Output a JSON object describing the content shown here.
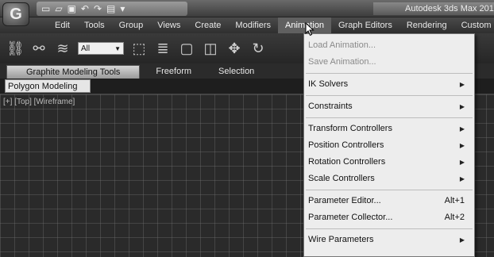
{
  "titlebar": {
    "app_button": "G",
    "title": "Autodesk 3ds Max 201",
    "quick_access_icons": [
      "new-file-icon",
      "open-file-icon",
      "save-icon",
      "undo-icon",
      "redo-icon",
      "project-folder-icon"
    ]
  },
  "menubar": {
    "items": [
      "Edit",
      "Tools",
      "Group",
      "Views",
      "Create",
      "Modifiers",
      "Animation",
      "Graph Editors",
      "Rendering",
      "Custom"
    ],
    "active": "Animation"
  },
  "toolbar": {
    "selection_filter": "All"
  },
  "ribbon": {
    "tabs": [
      "Graphite Modeling Tools",
      "Freeform",
      "Selection"
    ],
    "active_panel": "Polygon Modeling"
  },
  "viewport": {
    "label": "[+] [Top] [Wireframe]"
  },
  "animation_menu": {
    "items": [
      {
        "label": "Load Animation...",
        "shortcut": "",
        "submenu": false,
        "disabled": true
      },
      {
        "label": "Save Animation...",
        "shortcut": "",
        "submenu": false,
        "disabled": true
      },
      {
        "label": "IK Solvers",
        "shortcut": "",
        "submenu": true,
        "disabled": false
      },
      {
        "label": "Constraints",
        "shortcut": "",
        "submenu": true,
        "disabled": false
      },
      {
        "label": "Transform Controllers",
        "shortcut": "",
        "submenu": true,
        "disabled": false
      },
      {
        "label": "Position Controllers",
        "shortcut": "",
        "submenu": true,
        "disabled": false
      },
      {
        "label": "Rotation Controllers",
        "shortcut": "",
        "submenu": true,
        "disabled": false
      },
      {
        "label": "Scale Controllers",
        "shortcut": "",
        "submenu": true,
        "disabled": false
      },
      {
        "label": "Parameter Editor...",
        "shortcut": "Alt+1",
        "submenu": false,
        "disabled": false
      },
      {
        "label": "Parameter Collector...",
        "shortcut": "Alt+2",
        "submenu": false,
        "disabled": false
      },
      {
        "label": "Wire Parameters",
        "shortcut": "",
        "submenu": true,
        "disabled": false
      }
    ]
  }
}
